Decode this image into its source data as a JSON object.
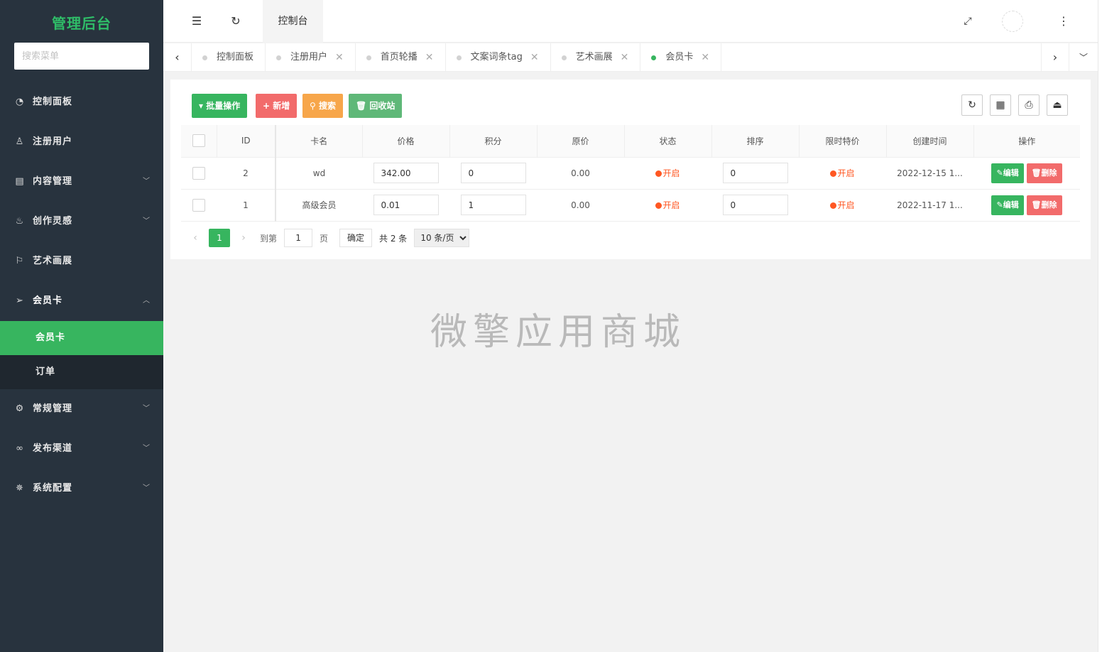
{
  "sidebar": {
    "logo": "管理后台",
    "search_placeholder": "搜索菜单",
    "items": [
      {
        "label": "控制面板",
        "icon": "dashboard-icon",
        "glyph": "◔"
      },
      {
        "label": "注册用户",
        "icon": "user-icon",
        "glyph": "♙"
      },
      {
        "label": "内容管理",
        "icon": "content-icon",
        "glyph": "▤"
      },
      {
        "label": "创作灵感",
        "icon": "fire-icon",
        "glyph": "♨"
      },
      {
        "label": "艺术画展",
        "icon": "flag-icon",
        "glyph": "⚐"
      },
      {
        "label": "会员卡",
        "icon": "send-icon",
        "glyph": "➢"
      },
      {
        "label": "常规管理",
        "icon": "gear-icon",
        "glyph": "⚙"
      },
      {
        "label": "发布渠道",
        "icon": "link-icon",
        "glyph": "∞"
      },
      {
        "label": "系统配置",
        "icon": "cog-icon",
        "glyph": "✵"
      }
    ],
    "submenu": [
      {
        "label": "会员卡"
      },
      {
        "label": "订单"
      }
    ]
  },
  "header": {
    "tab_label": "控制台"
  },
  "tabs": [
    {
      "label": "控制面板"
    },
    {
      "label": "注册用户"
    },
    {
      "label": "首页轮播"
    },
    {
      "label": "文案词条tag"
    },
    {
      "label": "艺术画展"
    },
    {
      "label": "会员卡"
    }
  ],
  "toolbar": {
    "batch": "批量操作",
    "add": "新增",
    "search": "搜索",
    "recycle": "回收站"
  },
  "table": {
    "columns": [
      "ID",
      "卡名",
      "价格",
      "积分",
      "原价",
      "状态",
      "排序",
      "限时特价",
      "创建时间",
      "操作"
    ],
    "rows": [
      {
        "id": "2",
        "name": "wd",
        "price": "342.00",
        "points": "0",
        "original": "0.00",
        "status": "开启",
        "sort": "0",
        "special": "开启",
        "created": "2022-12-15 1..."
      },
      {
        "id": "1",
        "name": "高级会员",
        "price": "0.01",
        "points": "1",
        "original": "0.00",
        "status": "开启",
        "sort": "0",
        "special": "开启",
        "created": "2022-11-17 1..."
      }
    ],
    "edit_label": "编辑",
    "delete_label": "删除"
  },
  "pager": {
    "current": "1",
    "goto_prefix": "到第",
    "goto_value": "1",
    "goto_suffix": "页",
    "confirm": "确定",
    "total": "共 2 条",
    "page_size": "10 条/页"
  },
  "watermark": "微擎应用商城",
  "colors": {
    "sidebar_bg": "#28333e",
    "accent_green": "#37b55f",
    "danger": "#f26b6b",
    "warning": "#f7a64a",
    "status": "#ff5722"
  }
}
